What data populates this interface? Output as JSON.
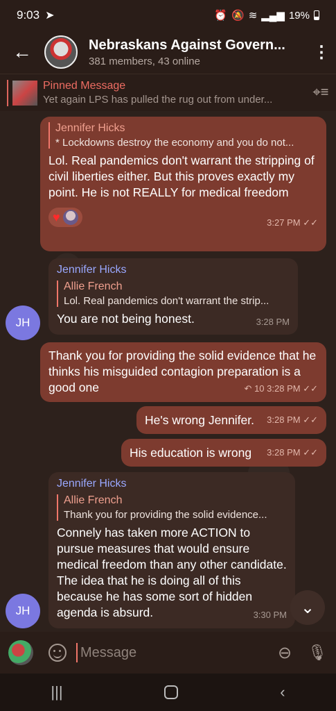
{
  "status": {
    "time": "9:03",
    "battery": "19%"
  },
  "header": {
    "title": "Nebraskans Against Govern...",
    "subtitle": "381 members, 43 online"
  },
  "pinned": {
    "title": "Pinned Message",
    "preview": "Yet again LPS has pulled the rug out from under..."
  },
  "messages": [
    {
      "reply_name": "Jennifer Hicks",
      "reply_text": "* Lockdowns destroy the economy and you do not...",
      "text": "Lol. Real pandemics don't warrant the stripping of civil liberties either. But this proves exactly my point. He is not REALLY for medical freedom",
      "time": "3:27 PM"
    },
    {
      "sender": "Jennifer Hicks",
      "reply_name": "Allie French",
      "reply_text": "Lol. Real pandemics don't warrant the strip...",
      "text": "You are not being honest.",
      "time": "3:28 PM",
      "avatar": "JH"
    },
    {
      "text": "Thank you for providing the solid evidence that he thinks his misguided contagion preparation is a good one",
      "replies": "10",
      "time": "3:28 PM"
    },
    {
      "text": "He's wrong Jennifer.",
      "time": "3:28 PM"
    },
    {
      "text": "His education is wrong",
      "time": "3:28 PM"
    },
    {
      "sender": "Jennifer Hicks",
      "reply_name": "Allie French",
      "reply_text": "Thank you for providing the solid evidence...",
      "text": "Connely has taken more ACTION to pursue measures that would ensure medical freedom than any other candidate. The idea that he is doing all of this because he has some sort of hidden agenda is absurd.",
      "time": "3:30 PM",
      "avatar": "JH"
    }
  ],
  "input": {
    "placeholder": "Message"
  },
  "colors": {
    "outgoing": "#7d3b2f",
    "incoming": "#3c2a24",
    "avatar": "#7b78e0",
    "accent": "#f0766a"
  }
}
